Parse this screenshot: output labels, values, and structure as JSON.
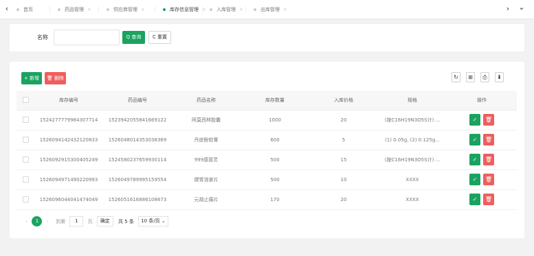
{
  "tabs": {
    "prev_icon": "‹",
    "next_icon": "›",
    "dropdown_icon": "⌄",
    "close_glyph": "×",
    "items": [
      {
        "label": "首页",
        "active": false
      },
      {
        "label": "药品管理",
        "active": false
      },
      {
        "label": "供应商管理",
        "active": false
      },
      {
        "label": "库存信息管理",
        "active": true
      },
      {
        "label": "入库管理",
        "active": false
      },
      {
        "label": "出库管理",
        "active": false
      }
    ]
  },
  "search": {
    "label": "名称",
    "placeholder": "",
    "query_label": "Q 查询",
    "reset_label": "C 重置"
  },
  "toolbar": {
    "add_label": "+ 新增",
    "delete_label": "🗑 删除",
    "refresh_icon": "↻",
    "columns_icon": "⊞",
    "print_icon": "⎙",
    "export_icon": "⬇"
  },
  "table": {
    "headers": [
      "库存编号",
      "药品编号",
      "药品名称",
      "库存数量",
      "入库价格",
      "规格",
      "操作"
    ],
    "rows": [
      {
        "stock_id": "1524277779984307714",
        "drug_id": "1523942055841669122",
        "name": "阿莫西林胶囊",
        "qty": "1000",
        "price": "20",
        "spec": "(按C16H19N3O5S计) ..."
      },
      {
        "stock_id": "1526094142432120833",
        "drug_id": "1526048014353038369",
        "name": "丹皮酚软膏",
        "qty": "600",
        "price": "5",
        "spec": "(1) 0.05g, (2) 0.125g..."
      },
      {
        "stock_id": "1526092915300405249",
        "drug_id": "1524580237659930114",
        "name": "999感冒灵",
        "qty": "500",
        "price": "15",
        "spec": "(按C16H19N3O5S计) ..."
      },
      {
        "stock_id": "1526094971490220993",
        "drug_id": "1526049789995159554",
        "name": "健胃消食片",
        "qty": "500",
        "price": "10",
        "spec": "XXXX"
      },
      {
        "stock_id": "1526096044041474049",
        "drug_id": "1526051616886108673",
        "name": "元胡止痛片",
        "qty": "170",
        "price": "20",
        "spec": "XXXX"
      }
    ],
    "edit_icon": "✓",
    "delete_icon": "🗑"
  },
  "pager": {
    "prev": "‹",
    "current": "1",
    "next": "›",
    "goto_label": "到第",
    "page_value": "1",
    "page_unit": "页",
    "confirm": "确定",
    "total": "共 5 条",
    "page_size": "10 条/页 ⌄"
  },
  "colors": {
    "primary": "#1aa35f",
    "danger": "#ee5e5e"
  }
}
